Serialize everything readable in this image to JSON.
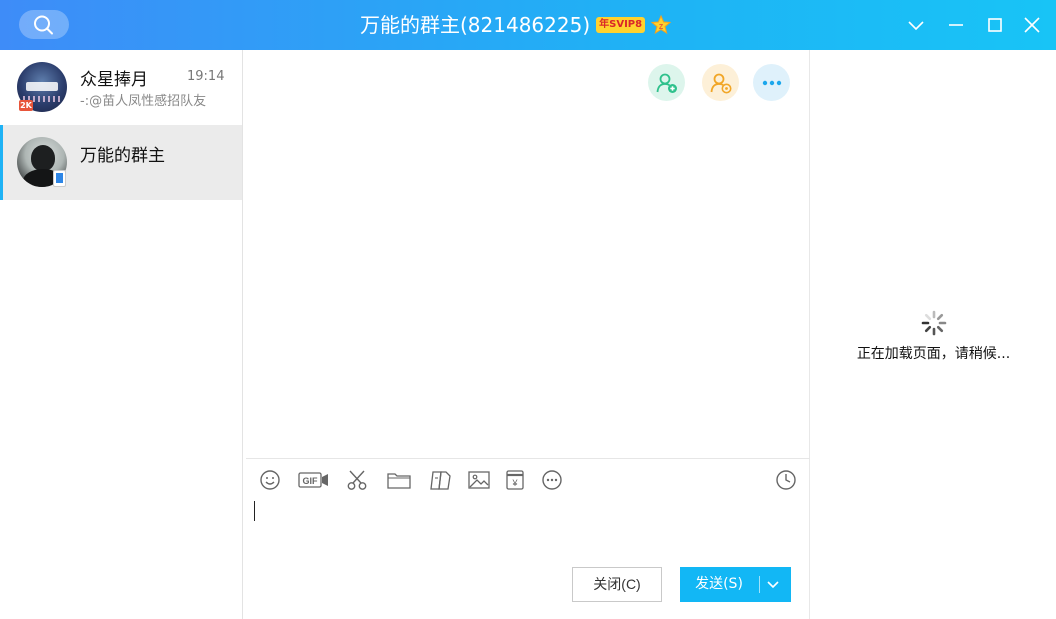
{
  "titlebar": {
    "title": "万能的群主(821486225)",
    "vip_badge": "年SVIP8",
    "colors": {
      "start": "#3e8cf8",
      "end": "#18c4f6"
    }
  },
  "sidebar": {
    "conversations": [
      {
        "name": "众星捧月",
        "time": "19:14",
        "preview": "-:@苗人凤性感招队友",
        "badge": "2K",
        "selected": false
      },
      {
        "name": "万能的群主",
        "time": "",
        "preview": "",
        "badge": "",
        "selected": true
      }
    ]
  },
  "chat": {
    "icons": [
      "add-member-icon",
      "group-member-icon",
      "more-icon"
    ],
    "toolbar_icons": [
      "emoji-icon",
      "gif-icon",
      "screenshot-icon",
      "folder-icon",
      "file-icon",
      "image-icon",
      "red-packet-icon",
      "more-tools-icon",
      "history-icon"
    ],
    "gif_label": "GIF",
    "close_label": "关闭(C)",
    "send_label": "发送(S)",
    "accent": "#12b7f5"
  },
  "rightpanel": {
    "loading_text": "正在加载页面，请稍候..."
  }
}
